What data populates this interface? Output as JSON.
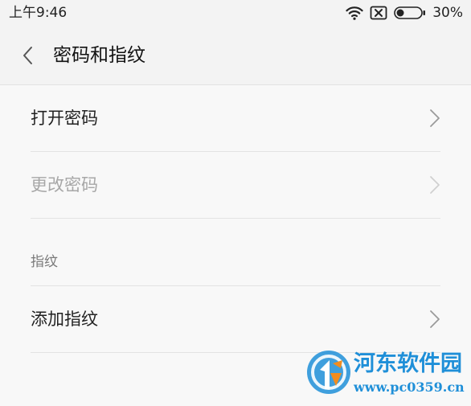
{
  "status_bar": {
    "time": "上午9:46",
    "battery_percent": "30%",
    "battery_level": 0.3,
    "icons": [
      "wifi-icon",
      "sim-no-signal-icon",
      "battery-icon"
    ]
  },
  "header": {
    "back_icon": "chevron-left-icon",
    "title": "密码和指纹"
  },
  "settings": {
    "rows": [
      {
        "label": "打开密码",
        "enabled": true
      },
      {
        "label": "更改密码",
        "enabled": false
      }
    ],
    "section_fingerprint": {
      "title": "指纹",
      "rows": [
        {
          "label": "添加指纹",
          "enabled": true
        }
      ]
    }
  },
  "watermark": {
    "name": "河东软件园",
    "url": "www.pc0359.cn"
  },
  "colors": {
    "background": "#f8f8f8",
    "header_background": "#f3f3f3",
    "text_primary": "#222222",
    "text_disabled": "#a7a7a7",
    "section_label": "#7a7a7a",
    "divider": "#e3e3e3",
    "watermark_blue": "#1f8fd8",
    "watermark_orange": "#f28c1e"
  }
}
